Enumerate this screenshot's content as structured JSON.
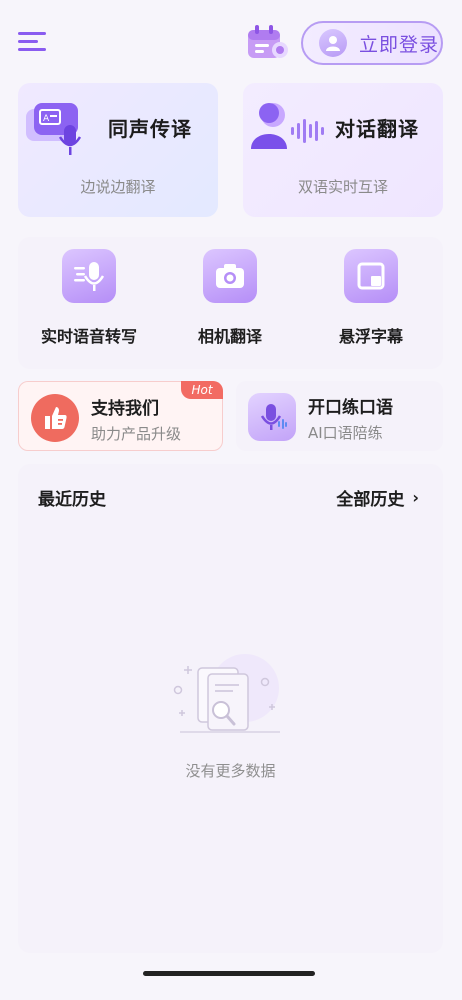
{
  "header": {
    "login_label": "立即登录",
    "icons": {
      "menu": "menu-icon",
      "calendar": "calendar-icon",
      "avatar": "user-avatar-icon"
    }
  },
  "features": [
    {
      "title": "同声传译",
      "subtitle": "边说边翻译",
      "icon": "simultaneous-translation-icon"
    },
    {
      "title": "对话翻译",
      "subtitle": "双语实时互译",
      "icon": "conversation-translation-icon"
    }
  ],
  "tools": [
    {
      "label": "实时语音转写",
      "icon": "voice-transcribe-icon"
    },
    {
      "label": "相机翻译",
      "icon": "camera-icon"
    },
    {
      "label": "悬浮字幕",
      "icon": "floating-subtitle-icon"
    }
  ],
  "promos": [
    {
      "title": "支持我们",
      "subtitle": "助力产品升级",
      "badge": "Hot",
      "icon": "thumbs-up-icon"
    },
    {
      "title": "开口练口语",
      "subtitle": "AI口语陪练",
      "icon": "microphone-icon"
    }
  ],
  "history": {
    "title": "最近历史",
    "all_label": "全部历史",
    "chevron": "›",
    "empty_text": "没有更多数据"
  },
  "colors": {
    "accent": "#8a5cf0",
    "hot": "#f26b63",
    "thumb_bg": "#ef6b5f"
  }
}
